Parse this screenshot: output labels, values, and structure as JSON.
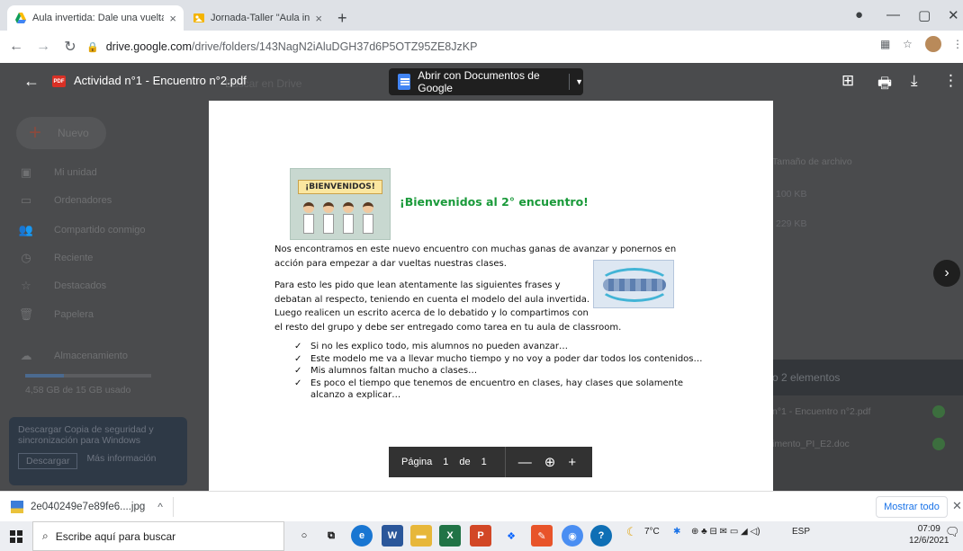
{
  "browser": {
    "tabs": [
      {
        "title": "Aula invertida: Dale una vuelta a",
        "close": "×"
      },
      {
        "title": "Jornada-Taller \"Aula invertida: De",
        "close": "×"
      }
    ],
    "new_tab": "+",
    "window_controls": [
      "—",
      "▢",
      "✕"
    ],
    "url_host": "drive.google.com",
    "url_path": "/drive/folders/143NagN2iAluDGH37d6P5OTZ95ZE8JzKP"
  },
  "drive_background": {
    "new_button": "Nuevo",
    "sidebar": [
      {
        "label": "Mi unidad",
        "icon": "drive-icon"
      },
      {
        "label": "Ordenadores",
        "icon": "computer-icon"
      },
      {
        "label": "Compartido conmigo",
        "icon": "people-icon"
      },
      {
        "label": "Reciente",
        "icon": "clock-icon"
      },
      {
        "label": "Destacados",
        "icon": "star-icon"
      },
      {
        "label": "Papelera",
        "icon": "trash-icon"
      },
      {
        "label": "Almacenamiento",
        "icon": "cloud-icon"
      }
    ],
    "storage_text": "4,58 GB de 15 GB usado",
    "storage_fraction": 0.31,
    "search_placeholder": "Buscar en Drive",
    "column_header": "Tamaño de archivo",
    "sizes": [
      "100 KB",
      "229 KB"
    ],
    "promo": {
      "text": "Descargar Copia de seguridad y sincronización para Windows",
      "download": "Descargar",
      "more": "Más información"
    },
    "upload_panel": {
      "header": "o 2 elementos",
      "items": [
        "n°1 - Encuentro n°2.pdf",
        "imento_PI_E2.doc"
      ]
    }
  },
  "viewer": {
    "file_name": "Actividad n°1 - Encuentro n°2.pdf",
    "open_with": "Abrir con Documentos de Google"
  },
  "document": {
    "banner": "¡BIENVENIDOS!",
    "heading": "¡Bienvenidos al 2° encuentro!",
    "paragraph1": [
      "Nos encontramos en este nuevo encuentro con muchas ganas de avanzar y ponernos en",
      "acción para empezar a dar vueltas nuestras clases."
    ],
    "paragraph2": [
      "Para esto les pido que lean atentamente las siguientes frases y",
      "debatan al respecto, teniendo en cuenta el modelo del aula invertida.",
      "Luego realicen un escrito acerca de lo debatido y lo compartimos con",
      "el resto del grupo y debe ser entregado como tarea en tu aula de classroom."
    ],
    "bullet_mark": "✓",
    "bullets": [
      "Si no les explico todo, mis alumnos no pueden avanzar…",
      "Este modelo me va a llevar mucho tiempo y no voy a poder dar todos los contenidos…",
      "Mis alumnos faltan mucho a clases…",
      "Es poco el tiempo que tenemos de encuentro en clases, hay clases que solamente",
      "alcanzo a explicar…"
    ]
  },
  "pager": {
    "label": "Página",
    "current": "1",
    "of": "de",
    "total": "1",
    "zoom_out": "—",
    "zoom_in": "+"
  },
  "download_shelf": {
    "file": "2e040249e7e89fe6....jpg",
    "show_all": "Mostrar todo"
  },
  "taskbar": {
    "search_placeholder": "Escribe aquí para buscar",
    "temperature": "7°C",
    "language": "ESP",
    "time": "07:09",
    "date": "12/6/2021"
  }
}
